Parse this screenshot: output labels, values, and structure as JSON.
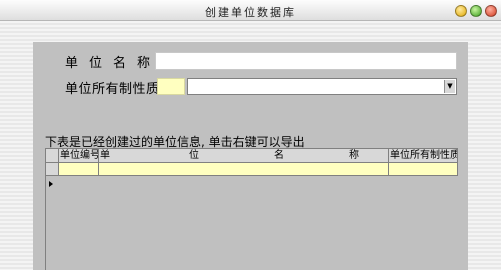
{
  "window": {
    "title": "创建单位数据库"
  },
  "form": {
    "name_label": "单位名称",
    "name_value": "",
    "ownership_label": "单位所有制性质",
    "ownership_code": "",
    "ownership_value": ""
  },
  "hint": "下表是已经创建过的单位信息, 单击右键可以导出",
  "table": {
    "columns": {
      "code": "单位编号",
      "name_chars": [
        "单",
        "位",
        "名",
        "称"
      ],
      "ownership": "单位所有制性质"
    },
    "rows": [
      {
        "code": "",
        "name": "",
        "ownership": ""
      }
    ]
  },
  "colors": {
    "panel": "#c0c0c0",
    "highlight_cell": "#ffffc0"
  }
}
